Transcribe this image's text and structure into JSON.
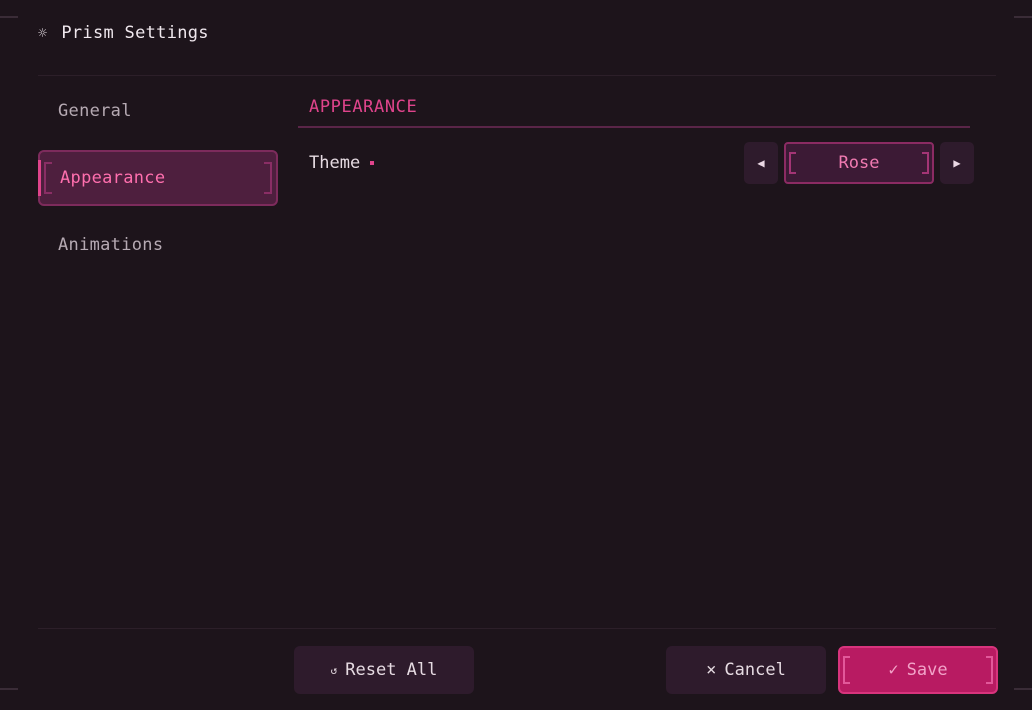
{
  "window": {
    "title": "Prism Settings",
    "title_icon": "gear-icon"
  },
  "sidebar": {
    "items": [
      {
        "label": "General",
        "active": false
      },
      {
        "label": "Appearance",
        "active": true
      },
      {
        "label": "Animations",
        "active": false
      }
    ]
  },
  "main": {
    "section_title": "APPEARANCE",
    "settings": [
      {
        "label": "Theme",
        "modified_indicator": "pink-dot",
        "value": "Rose",
        "prev_icon": "left-arrow-icon",
        "next_icon": "right-arrow-icon"
      }
    ]
  },
  "footer": {
    "reset_label": "Reset All",
    "reset_icon": "↺",
    "cancel_label": "Cancel",
    "cancel_icon": "×",
    "save_label": "Save",
    "save_icon": "✓"
  },
  "colors": {
    "background": "#1d141b",
    "accent": "#e0448c",
    "save_button": "#b81b62",
    "button": "#2e1b2c"
  }
}
